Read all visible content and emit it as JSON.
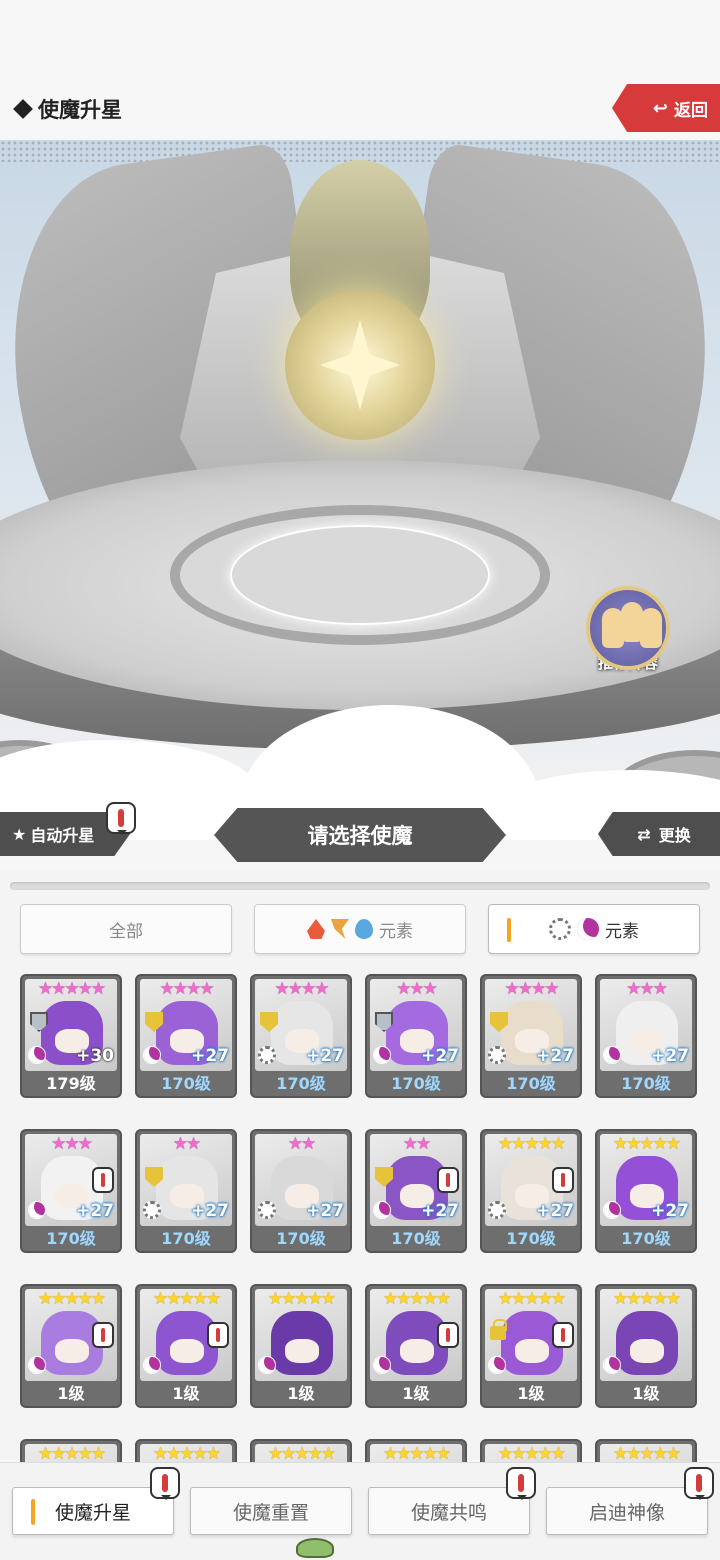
{
  "header": {
    "title": "使魔升星",
    "back_label": "返回"
  },
  "scene": {
    "recommend_label": "推荐阵容"
  },
  "selection": {
    "auto_star_label": "自动升星",
    "choose_label": "请选择使魔",
    "swap_label": "更换"
  },
  "filters": {
    "all_label": "全部",
    "element_label_1": "元素",
    "element_label_2": "元素"
  },
  "cards": [
    {
      "stars": "★★★★★",
      "star_color": "pink",
      "plus": "+30",
      "level": "179级",
      "element": "dark",
      "shield": "silver",
      "theme": "#8b4fc9"
    },
    {
      "stars": "★★★★",
      "star_color": "pink",
      "plus": "+27",
      "level": "170级",
      "element": "dark",
      "shield": "gold",
      "theme": "#9b62d6"
    },
    {
      "stars": "★★★★",
      "star_color": "pink",
      "plus": "+27",
      "level": "170级",
      "element": "light",
      "shield": "gold",
      "theme": "#e6e6e6"
    },
    {
      "stars": "★★★",
      "star_color": "pink",
      "plus": "+27",
      "level": "170级",
      "element": "dark",
      "shield": "silver",
      "theme": "#a46be0"
    },
    {
      "stars": "★★★★",
      "star_color": "pink",
      "plus": "+27",
      "level": "170级",
      "element": "light",
      "shield": "gold",
      "theme": "#e8dccb"
    },
    {
      "stars": "★★★",
      "star_color": "pink",
      "plus": "+27",
      "level": "170级",
      "element": "dark",
      "shield": "",
      "theme": "#efefef"
    },
    {
      "stars": "★★★",
      "star_color": "pink",
      "plus": "+27",
      "level": "170级",
      "element": "dark",
      "shield": "",
      "alert": true,
      "theme": "#f2f2f2"
    },
    {
      "stars": "★★",
      "star_color": "pink",
      "plus": "+27",
      "level": "170级",
      "element": "light",
      "shield": "gold",
      "theme": "#e5e5e5"
    },
    {
      "stars": "★★",
      "star_color": "pink",
      "plus": "+27",
      "level": "170级",
      "element": "light",
      "shield": "",
      "theme": "#d9d9d9"
    },
    {
      "stars": "★★",
      "star_color": "pink",
      "plus": "+27",
      "level": "170级",
      "element": "dark",
      "shield": "gold",
      "alert": true,
      "theme": "#8a55c4"
    },
    {
      "stars": "★★★★★",
      "star_color": "gold",
      "plus": "+27",
      "level": "170级",
      "element": "light",
      "shield": "",
      "alert": true,
      "theme": "#e8e2da"
    },
    {
      "stars": "★★★★★",
      "star_color": "gold",
      "plus": "+27",
      "level": "170级",
      "element": "dark",
      "shield": "",
      "theme": "#9550d8"
    },
    {
      "stars": "★★★★★",
      "star_color": "gold",
      "plus": "",
      "level": "1级",
      "element": "dark",
      "shield": "",
      "alert": true,
      "theme": "#a97de0"
    },
    {
      "stars": "★★★★★",
      "star_color": "gold",
      "plus": "",
      "level": "1级",
      "element": "dark",
      "shield": "",
      "alert": true,
      "theme": "#8d55d0"
    },
    {
      "stars": "★★★★★",
      "star_color": "gold",
      "plus": "",
      "level": "1级",
      "element": "dark",
      "shield": "",
      "theme": "#6a3aa8"
    },
    {
      "stars": "★★★★★",
      "star_color": "gold",
      "plus": "",
      "level": "1级",
      "element": "dark",
      "shield": "",
      "alert": true,
      "theme": "#7e4cbc"
    },
    {
      "stars": "★★★★★",
      "star_color": "gold",
      "plus": "",
      "level": "1级",
      "element": "dark",
      "shield": "",
      "alert": true,
      "lock": true,
      "theme": "#9a5ad6"
    },
    {
      "stars": "★★★★★",
      "star_color": "gold",
      "plus": "",
      "level": "1级",
      "element": "dark",
      "shield": "",
      "theme": "#7a45b5"
    },
    {
      "stars": "★★★★★",
      "star_color": "gold",
      "plus": "",
      "level": "",
      "element": "",
      "shield": "",
      "theme": "#e6e6e6"
    },
    {
      "stars": "★★★★★",
      "star_color": "gold",
      "plus": "",
      "level": "",
      "element": "",
      "shield": "",
      "theme": "#e6e6e6"
    },
    {
      "stars": "★★★★★",
      "star_color": "gold",
      "plus": "",
      "level": "",
      "element": "",
      "shield": "",
      "theme": "#e6e6e6"
    },
    {
      "stars": "★★★★★",
      "star_color": "gold",
      "plus": "",
      "level": "",
      "element": "",
      "shield": "",
      "theme": "#e6e6e6"
    },
    {
      "stars": "★★★★★",
      "star_color": "gold",
      "plus": "",
      "level": "",
      "element": "",
      "shield": "",
      "theme": "#e6e6e6"
    },
    {
      "stars": "★★★★★",
      "star_color": "gold",
      "plus": "",
      "level": "",
      "element": "",
      "shield": "",
      "theme": "#e6e6e6"
    }
  ],
  "bottom_nav": {
    "tabs": [
      {
        "label": "使魔升星",
        "active": true,
        "alert": true
      },
      {
        "label": "使魔重置",
        "active": false,
        "alert": false
      },
      {
        "label": "使魔共鸣",
        "active": false,
        "alert": true
      },
      {
        "label": "启迪神像",
        "active": false,
        "alert": true
      }
    ]
  },
  "colors": {
    "accent_orange": "#f4a521",
    "back_red": "#d73a3a",
    "star_pink": "#f06bcc",
    "star_gold": "#ffd52b",
    "dark_element": "#b2339f"
  }
}
